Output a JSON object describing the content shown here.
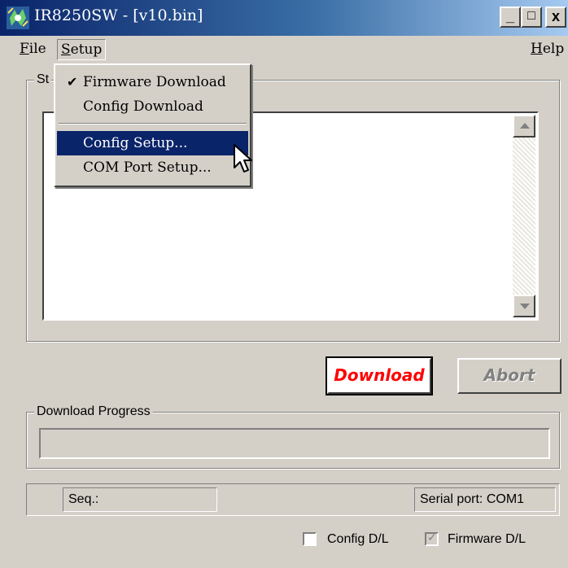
{
  "window": {
    "title": "IR8250SW - [v10.bin]",
    "minimize_label": "_",
    "maximize_label": "□",
    "close_label": "x"
  },
  "menubar": {
    "file": "File",
    "setup": "Setup",
    "help": "Help"
  },
  "setup_menu": {
    "items": [
      {
        "label": "Firmware Download",
        "checked": true
      },
      {
        "label": "Config Download",
        "checked": false
      },
      {
        "label": "Config Setup...",
        "highlighted": true
      },
      {
        "label": "COM Port Setup..."
      }
    ]
  },
  "status_group": {
    "label": "St"
  },
  "buttons": {
    "download": "Download",
    "abort": "Abort"
  },
  "progress_group": {
    "label": "Download Progress"
  },
  "statusbar": {
    "seq_label": "Seq.:",
    "serial_port": "Serial port: COM1"
  },
  "options": {
    "config_dl": {
      "label": "Config D/L",
      "checked": false
    },
    "firmware_dl": {
      "label": "Firmware D/L",
      "checked": true
    }
  },
  "icons": [
    "app-icon",
    "scroll-up-icon",
    "scroll-down-icon",
    "checkmark-icon",
    "mouse-cursor-icon"
  ],
  "colors": {
    "title_gradient_start": "#0a246a",
    "title_gradient_end": "#a6caf0",
    "download_text": "#ff0000",
    "menu_highlight": "#0a246a",
    "face": "#d4d0c8"
  }
}
